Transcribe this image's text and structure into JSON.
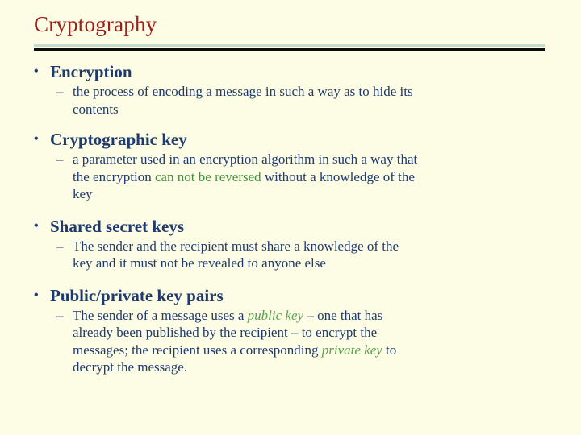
{
  "slide": {
    "title": "Cryptography",
    "bullet_marker": "•",
    "dash_marker": "–",
    "colors": {
      "background": "#fdfce4",
      "title_red": "#a01d1d",
      "body_navy": "#1e3a6e",
      "highlight_green": "#3f9640",
      "emphasis_green": "#5aa253",
      "rule_top": "#c3dcd3",
      "rule_bottom": "#0d0d0d"
    },
    "groups": [
      {
        "heading": "Encryption",
        "lines": [
          "the process of encoding a message in such a way as to hide its",
          "contents"
        ]
      },
      {
        "heading": "Cryptographic key",
        "lines": [
          "a parameter used in an encryption algorithm in such a way that",
          "the encryption can not be reversed without a knowledge of the",
          "key"
        ],
        "line2_parts": {
          "before": "the encryption ",
          "highlight": "can not be reversed",
          "after": " without a knowledge of the"
        }
      },
      {
        "heading": "Shared secret keys",
        "lines": [
          "The sender and the recipient must share a knowledge of the",
          "key and it must not be revealed to anyone else"
        ]
      },
      {
        "heading": "Public/private key pairs",
        "lines": [
          "The sender of a message uses a public key – one that has",
          "already been published by the recipient – to encrypt the",
          "messages; the recipient uses a corresponding private key to",
          "decrypt the message."
        ],
        "line1_parts": {
          "before": "The sender of a message uses a ",
          "emphasis": "public key",
          "after": " – one that has"
        },
        "line3_parts": {
          "before": "messages; the recipient uses a corresponding ",
          "emphasis": "private key",
          "after": " to"
        }
      }
    ]
  }
}
